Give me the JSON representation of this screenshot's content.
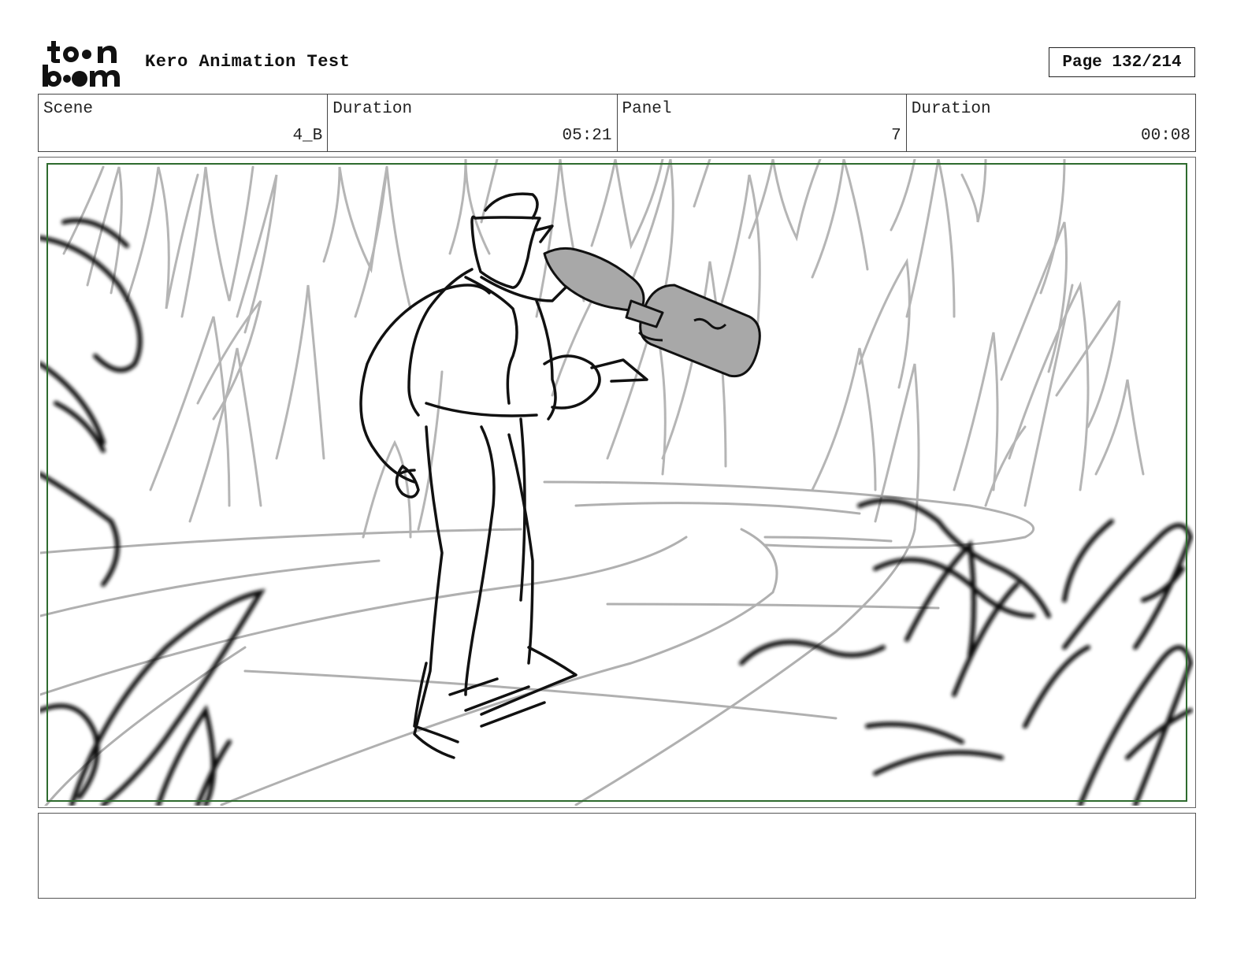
{
  "header": {
    "logo_text": "toon boom",
    "project_title": "Kero Animation Test",
    "page_label": "Page 132/214"
  },
  "info": [
    {
      "label": "Scene",
      "value": "4_B"
    },
    {
      "label": "Duration",
      "value": "05:21"
    },
    {
      "label": "Panel",
      "value": "7"
    },
    {
      "label": "Duration",
      "value": "00:08"
    }
  ],
  "panel": {
    "description": "",
    "colors": {
      "safe_frame": "#2e6b2e",
      "sketch_gray": "#b0b0b0",
      "ink": "#111111",
      "fill_gray": "#a8a8a8"
    }
  },
  "notes": {
    "text": ""
  }
}
